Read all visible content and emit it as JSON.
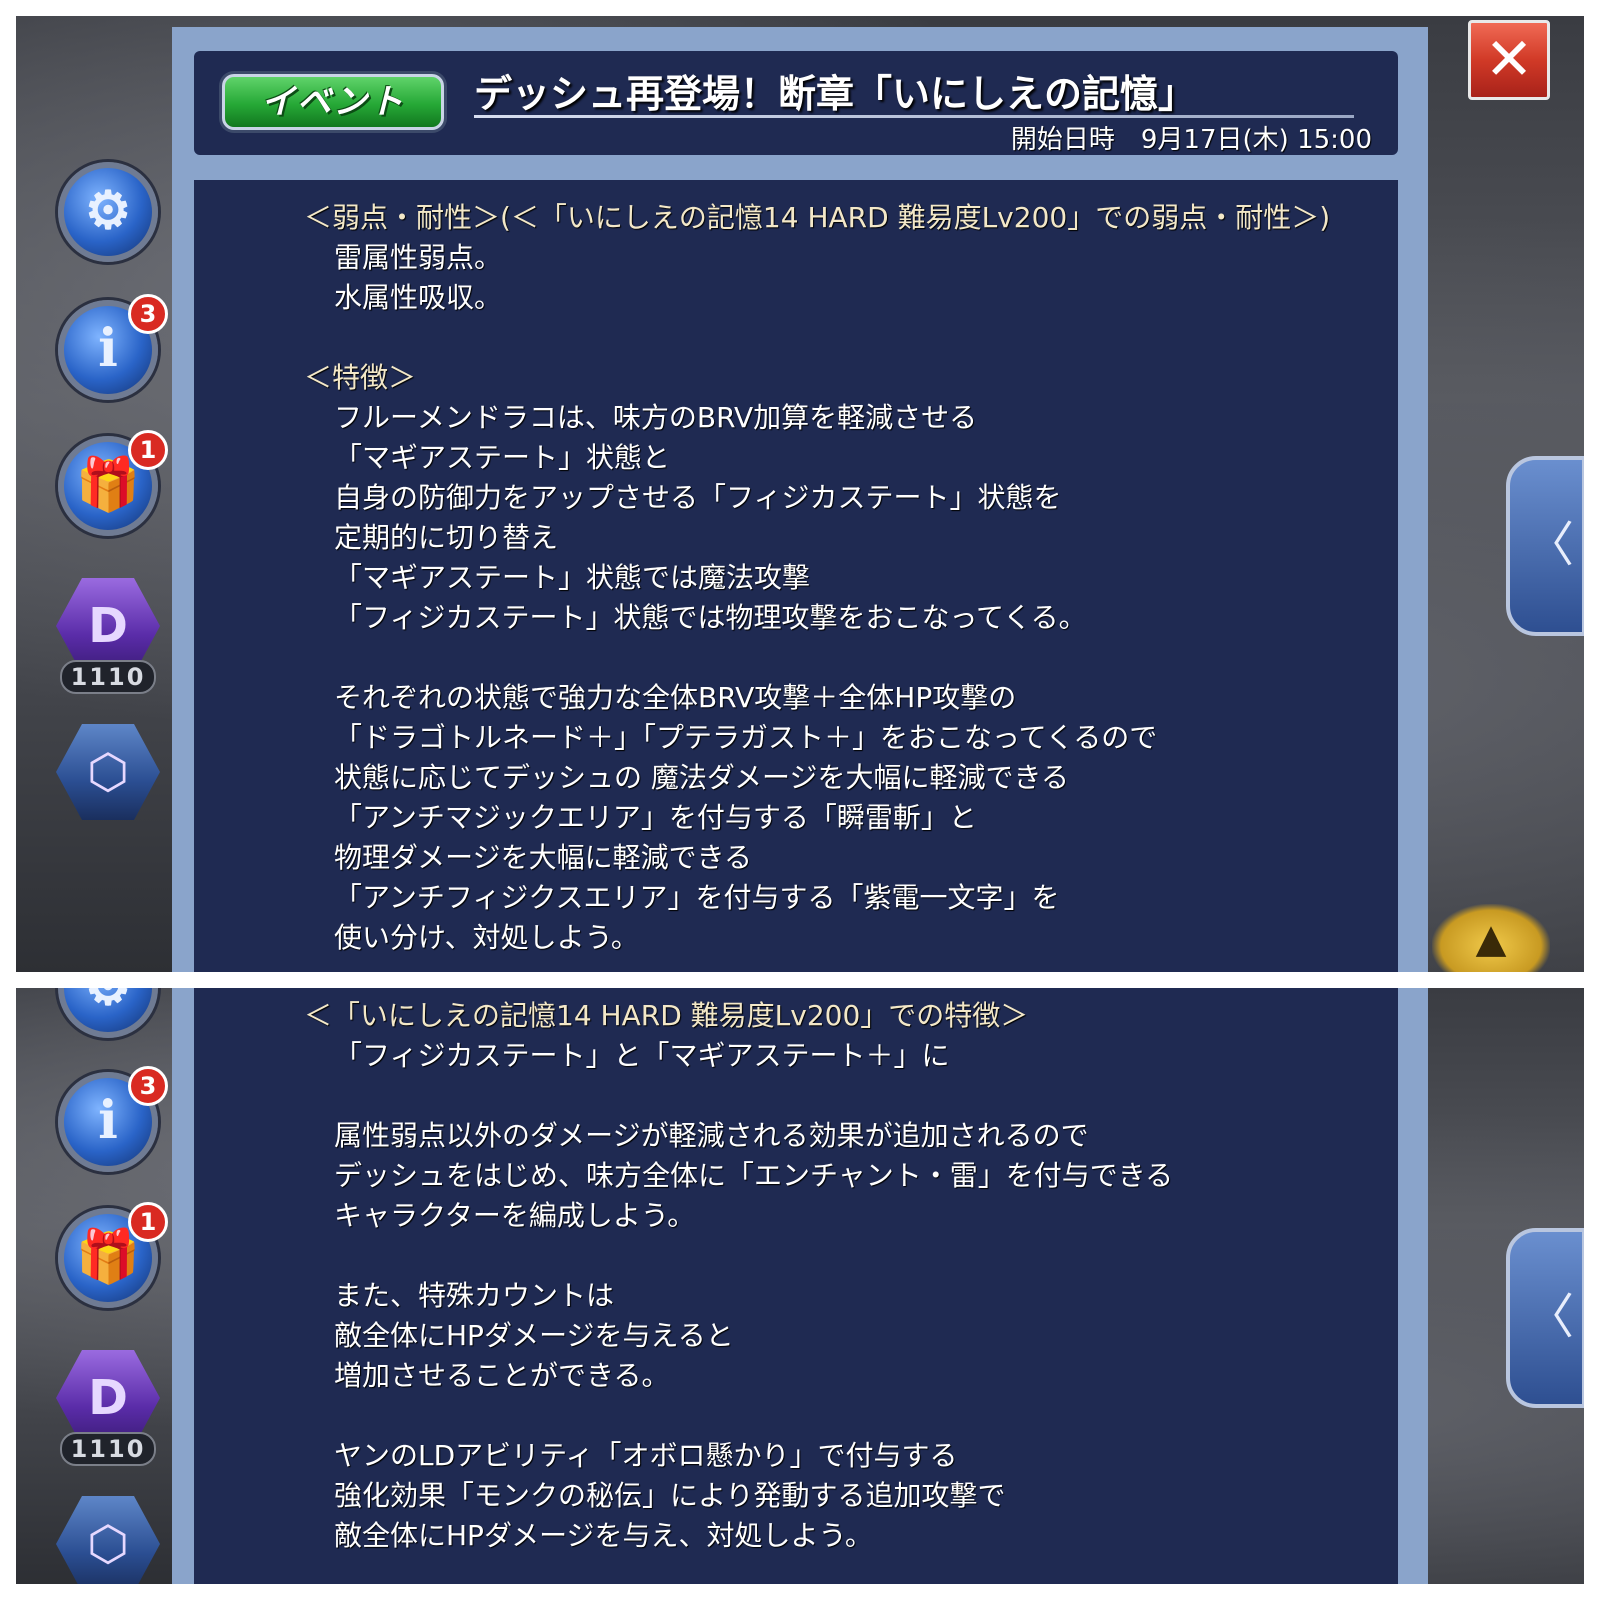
{
  "header": {
    "badge": "イベント",
    "title": "デッシュ再登場！断章「いにしえの記憶」",
    "start_label": "開始日時",
    "start_date": "9月17日(木) 15:00"
  },
  "close_button": {
    "glyph": "✕"
  },
  "sidebar": {
    "settings_glyph": "⚙",
    "info_glyph": "i",
    "info_badge": "3",
    "gift_glyph": "🎁",
    "gift_badge": "1",
    "dp_glyph": "D",
    "dp_count": "1110",
    "summon_glyph": "⬡"
  },
  "right_tab": {
    "glyph": "〈"
  },
  "content_top": [
    {
      "kind": "head",
      "text": "＜弱点・耐性＞(＜「いにしえの記憶14 HARD 難易度Lv200」での弱点・耐性＞)"
    },
    {
      "kind": "body",
      "text": "雷属性弱点。"
    },
    {
      "kind": "body",
      "text": "水属性吸収。"
    },
    {
      "kind": "gap",
      "text": ""
    },
    {
      "kind": "head",
      "text": "＜特徴＞"
    },
    {
      "kind": "body",
      "text": "フルーメンドラコは、味方のBRV加算を軽減させる"
    },
    {
      "kind": "body",
      "text": "「マギアステート」状態と"
    },
    {
      "kind": "body",
      "text": "自身の防御力をアップさせる「フィジカステート」状態を"
    },
    {
      "kind": "body",
      "text": "定期的に切り替え"
    },
    {
      "kind": "body",
      "text": "「マギアステート」状態では魔法攻撃"
    },
    {
      "kind": "body",
      "text": "「フィジカステート」状態では物理攻撃をおこなってくる。"
    },
    {
      "kind": "gap",
      "text": ""
    },
    {
      "kind": "body",
      "text": "それぞれの状態で強力な全体BRV攻撃＋全体HP攻撃の"
    },
    {
      "kind": "body",
      "text": "「ドラゴトルネード＋」「プテラガスト＋」をおこなってくるので"
    },
    {
      "kind": "body",
      "text": "状態に応じてデッシュの 魔法ダメージを大幅に軽減できる"
    },
    {
      "kind": "body",
      "text": "「アンチマジックエリア」を付与する「瞬雷斬」と"
    },
    {
      "kind": "body",
      "text": "物理ダメージを大幅に軽減できる"
    },
    {
      "kind": "body",
      "text": "「アンチフィジクスエリア」を付与する「紫電一文字」を"
    },
    {
      "kind": "body",
      "text": "使い分け、対処しよう。"
    }
  ],
  "content_bottom": [
    {
      "kind": "head",
      "text": "＜「いにしえの記憶14 HARD 難易度Lv200」での特徴＞"
    },
    {
      "kind": "body",
      "text": "「フィジカステート」と「マギアステート＋」に"
    },
    {
      "kind": "gap",
      "text": ""
    },
    {
      "kind": "body",
      "text": "属性弱点以外のダメージが軽減される効果が追加されるので"
    },
    {
      "kind": "body",
      "text": "デッシュをはじめ、味方全体に「エンチャント・雷」を付与できる"
    },
    {
      "kind": "body",
      "text": "キャラクターを編成しよう。"
    },
    {
      "kind": "gap",
      "text": ""
    },
    {
      "kind": "body",
      "text": "また、特殊カウントは"
    },
    {
      "kind": "body",
      "text": "敵全体にHPダメージを与えると"
    },
    {
      "kind": "body",
      "text": "増加させることができる。"
    },
    {
      "kind": "gap",
      "text": ""
    },
    {
      "kind": "body",
      "text": "ヤンのLDアビリティ「オボロ懸かり」で付与する"
    },
    {
      "kind": "body",
      "text": "強化効果「モンクの秘伝」により発動する追加攻撃で"
    },
    {
      "kind": "body",
      "text": "敵全体にHPダメージを与え、対処しよう。"
    }
  ]
}
